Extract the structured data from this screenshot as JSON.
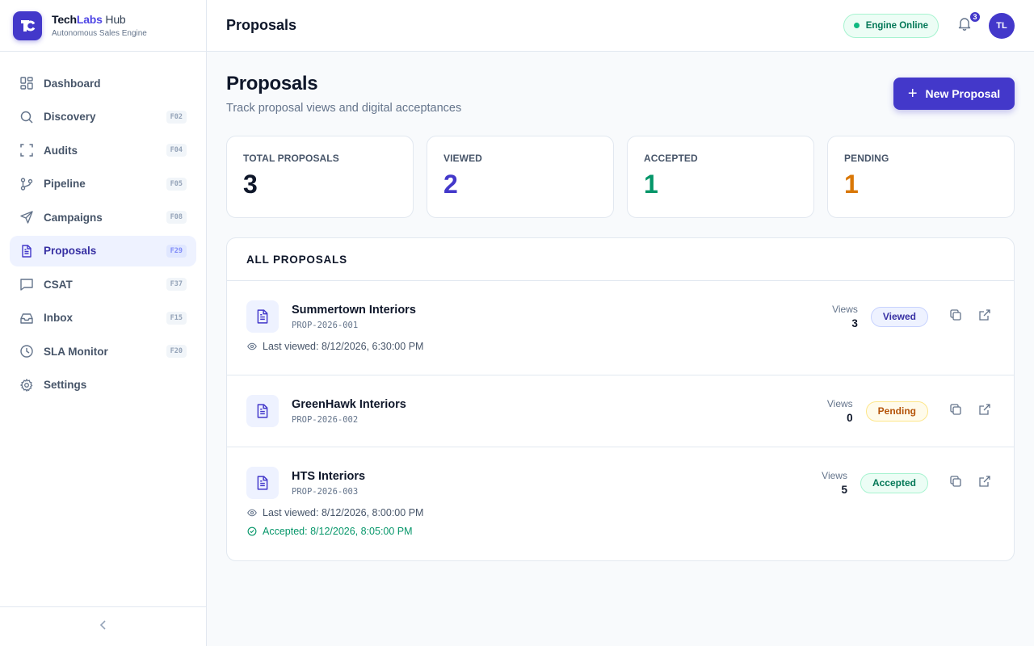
{
  "brand": {
    "name_a": "Tech",
    "name_b": "Labs",
    "name_c": " Hub",
    "subtitle": "Autonomous Sales Engine"
  },
  "sidebar": {
    "items": [
      {
        "label": "Dashboard",
        "shortcut": ""
      },
      {
        "label": "Discovery",
        "shortcut": "F02"
      },
      {
        "label": "Audits",
        "shortcut": "F04"
      },
      {
        "label": "Pipeline",
        "shortcut": "F05"
      },
      {
        "label": "Campaigns",
        "shortcut": "F08"
      },
      {
        "label": "Proposals",
        "shortcut": "F29"
      },
      {
        "label": "CSAT",
        "shortcut": "F37"
      },
      {
        "label": "Inbox",
        "shortcut": "F15"
      },
      {
        "label": "SLA Monitor",
        "shortcut": "F20"
      },
      {
        "label": "Settings",
        "shortcut": ""
      }
    ],
    "active": "Proposals"
  },
  "topbar": {
    "title": "Proposals",
    "engine_status": "Engine Online",
    "notification_count": "3",
    "avatar_initials": "TL"
  },
  "page": {
    "title": "Proposals",
    "subtitle": "Track proposal views and digital acceptances",
    "new_button": "New Proposal"
  },
  "stats": [
    {
      "label": "Total Proposals",
      "value": "3",
      "color": "#0f172a"
    },
    {
      "label": "Viewed",
      "value": "2",
      "color": "#4338ca"
    },
    {
      "label": "Accepted",
      "value": "1",
      "color": "#059669"
    },
    {
      "label": "Pending",
      "value": "1",
      "color": "#d97706"
    }
  ],
  "list": {
    "heading": "ALL PROPOSALS",
    "views_label": "Views",
    "rows": [
      {
        "name": "Summertown Interiors",
        "id": "PROP-2026-001",
        "views": "3",
        "status": "Viewed",
        "last_viewed": "Last viewed: 8/12/2026, 6:30:00 PM",
        "accepted": ""
      },
      {
        "name": "GreenHawk Interiors",
        "id": "PROP-2026-002",
        "views": "0",
        "status": "Pending",
        "last_viewed": "",
        "accepted": ""
      },
      {
        "name": "HTS Interiors",
        "id": "PROP-2026-003",
        "views": "5",
        "status": "Accepted",
        "last_viewed": "Last viewed: 8/12/2026, 8:00:00 PM",
        "accepted": "Accepted: 8/12/2026, 8:05:00 PM"
      }
    ]
  },
  "colors": {
    "accent": "#4338ca",
    "success": "#059669",
    "warning": "#d97706"
  }
}
